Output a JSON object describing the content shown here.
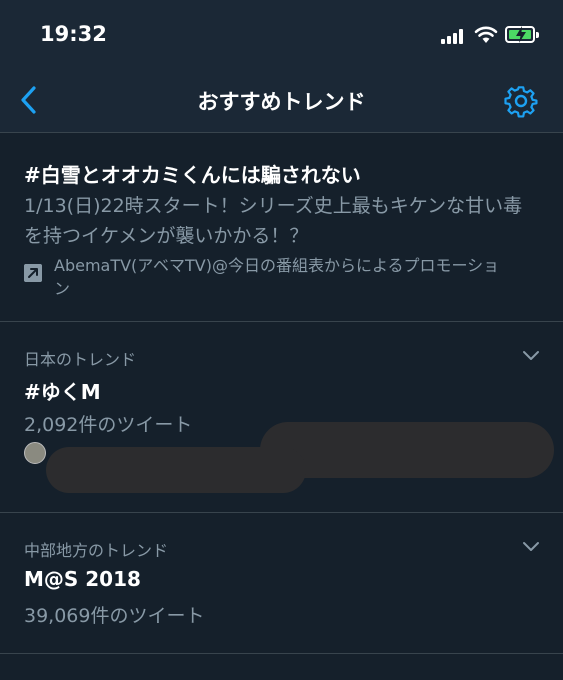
{
  "status": {
    "time": "19:32"
  },
  "nav": {
    "title": "おすすめトレンド"
  },
  "promoted": {
    "title": "#白雪とオオカミくんには騙されない",
    "description": "1/13(日)22時スタート！シリーズ史上最もキケンな甘い毒を持つイケメンが襲いかかる！？",
    "byline": "AbemaTV(アベマTV)@今日の番組表からによるプロモーション"
  },
  "trends": [
    {
      "context": "日本のトレンド",
      "name": "#ゆくM",
      "count": "2,092件のツイート"
    },
    {
      "context": "中部地方のトレンド",
      "name": "M@S 2018",
      "count": "39,069件のツイート"
    }
  ],
  "colors": {
    "background": "#15202b",
    "accent": "#1da1f2",
    "muted": "#8899a6",
    "divider": "#38444d"
  },
  "icons": [
    "back-icon",
    "gear-icon",
    "chevron-down-icon",
    "promoted-icon",
    "signal-icon",
    "wifi-icon",
    "battery-icon"
  ]
}
